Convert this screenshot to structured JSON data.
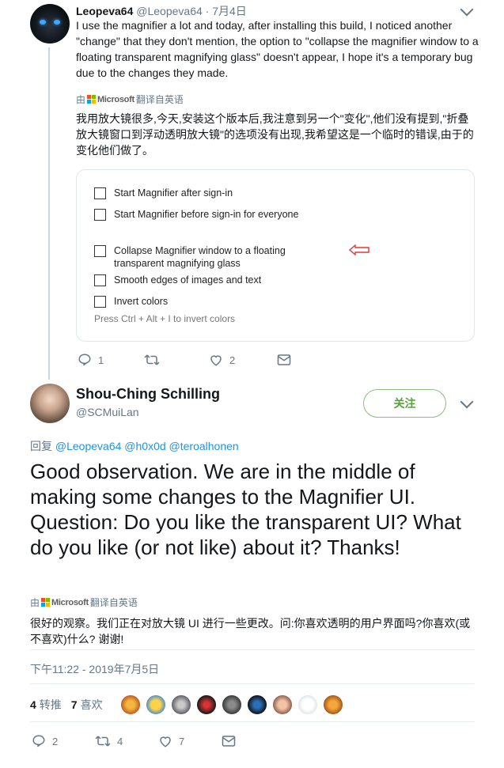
{
  "tweet1": {
    "name": "Leopeva64",
    "handle": "@Leopeva64",
    "date": "· 7月4日",
    "text": "I use the magnifier a lot and today, after installing this build, I noticed another \"change\" that they don't mention, the option to \"collapse the magnifier window to a floating transparent magnifying glass\" doesn't appear, I hope it's a temporary bug due to the changes they made.",
    "translated_prefix": "由",
    "translator_name": "Microsoft",
    "translated_suffix": "翻译自英语",
    "translation": "我用放大镜很多,今天,安装这个版本后,我注意到另一个\"变化\",他们没有提到,\"折叠放大镜窗口到浮动透明放大镜\"的选项没有出现,我希望这是一个临时的错误,由于的变化他们做了。",
    "card": {
      "options": [
        "Start Magnifier after sign-in",
        "Start Magnifier before sign-in for everyone",
        "Collapse Magnifier window to a floating transparent magnifying glass",
        "Smooth edges of images and text",
        "Invert colors"
      ],
      "hint": "Press Ctrl + Alt + I to invert colors"
    },
    "replies": "1",
    "retweets": "",
    "likes": "2"
  },
  "tweet2": {
    "name": "Shou-Ching Schilling",
    "handle": "@SCMuiLan",
    "follow_label": "关注",
    "reply_prefix": "回复",
    "reply_mentions": "@Leopeva64 @h0x0d @teroalhonen",
    "text": "Good observation. We are in the middle of making some changes to the Magnifier UI. Question: Do you like the transparent UI? What do you like (or not like) about it? Thanks!",
    "translated_prefix": "由",
    "translator_name": "Microsoft",
    "translated_suffix": "翻译自英语",
    "translation": "很好的观察。我们正在对放大镜 UI 进行一些更改。问:你喜欢透明的用户界面吗?你喜欢(或不喜欢)什么? 谢谢!",
    "timestamp": "下午11:22 - 2019年7月5日",
    "retweet_count": "4",
    "retweet_label": "转推",
    "like_count": "7",
    "like_label": "喜欢",
    "replies": "2",
    "retweets": "4",
    "likes": "7"
  },
  "colors": {
    "link": "#1b95e0",
    "muted": "#657786",
    "follow_green": "#5aa03f",
    "arrow_red": "#e0393e"
  },
  "icons": [
    "reply-icon",
    "retweet-icon",
    "like-icon",
    "message-icon",
    "chevron-down-icon",
    "microsoft-logo-icon"
  ]
}
